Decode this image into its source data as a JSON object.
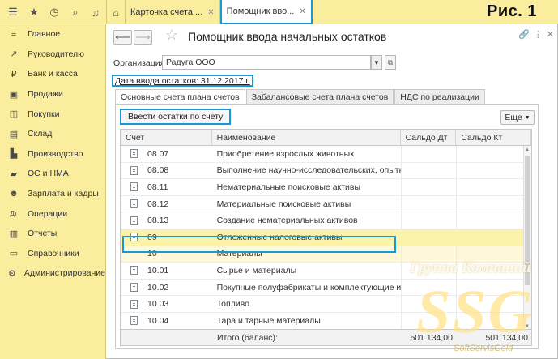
{
  "caption": "Рис. 1",
  "topbar": {
    "icons": [
      "menu-icon",
      "star-icon",
      "history-icon",
      "search-icon",
      "bell-icon"
    ],
    "home_icon": "home-icon",
    "tabs": [
      {
        "label": "Карточка счета ..."
      },
      {
        "label": "Помощник вво..."
      }
    ]
  },
  "sidebar": {
    "items": [
      {
        "label": "Главное",
        "icon": "≡"
      },
      {
        "label": "Руководителю",
        "icon": "↗"
      },
      {
        "label": "Банк и касса",
        "icon": "₽"
      },
      {
        "label": "Продажи",
        "icon": "▣"
      },
      {
        "label": "Покупки",
        "icon": "◫"
      },
      {
        "label": "Склад",
        "icon": "▤"
      },
      {
        "label": "Производство",
        "icon": "▙"
      },
      {
        "label": "ОС и НМА",
        "icon": "▰"
      },
      {
        "label": "Зарплата и кадры",
        "icon": "☻"
      },
      {
        "label": "Операции",
        "icon": "Дт"
      },
      {
        "label": "Отчеты",
        "icon": "▥"
      },
      {
        "label": "Справочники",
        "icon": "▭"
      },
      {
        "label": "Администрирование",
        "icon": "⚙"
      }
    ]
  },
  "form": {
    "title": "Помощник ввода начальных остатков",
    "org_label": "Организация:",
    "org_value": "Радуга ООО",
    "date_link": "Дата ввода остатков: 31.12.2017 г.",
    "tabs": [
      {
        "label": "Основные счета плана счетов"
      },
      {
        "label": "Забалансовые счета плана счетов"
      },
      {
        "label": "НДС по реализации"
      }
    ],
    "enter_button": "Ввести остатки по счету",
    "more_button": "Еще"
  },
  "table": {
    "headers": [
      "Счет",
      "Наименование",
      "Сальдо Дт",
      "Сальдо Кт"
    ],
    "rows": [
      {
        "account": "08.07",
        "name": "Приобретение взрослых животных",
        "icon": true
      },
      {
        "account": "08.08",
        "name": "Выполнение научно-исследовательских, опытн...",
        "icon": true
      },
      {
        "account": "08.11",
        "name": "Нематериальные поисковые активы",
        "icon": true
      },
      {
        "account": "08.12",
        "name": "Материальные поисковые активы",
        "icon": true
      },
      {
        "account": "08.13",
        "name": "Создание нематериальных активов",
        "icon": true
      },
      {
        "account": "09",
        "name": "Отложенные налоговые активы",
        "icon": true
      },
      {
        "account": "10",
        "name": "Материалы",
        "icon": false
      },
      {
        "account": "10.01",
        "name": "Сырье и материалы",
        "icon": true
      },
      {
        "account": "10.02",
        "name": "Покупные полуфабрикаты и комплектующие из...",
        "icon": true
      },
      {
        "account": "10.03",
        "name": "Топливо",
        "icon": true
      },
      {
        "account": "10.04",
        "name": "Тара и тарные материалы",
        "icon": true
      }
    ],
    "footer_label": "Итого (баланс):",
    "footer_dt": "501 134,00",
    "footer_kt": "501 134,00"
  },
  "watermark": {
    "line1": "Группа Компаний",
    "line2": "SSG",
    "line3": "SoftServisGold"
  },
  "colors": {
    "accent": "#1a98d5",
    "sidebar_bg": "#fbed9e",
    "selected_row": "#fbf3a9"
  }
}
